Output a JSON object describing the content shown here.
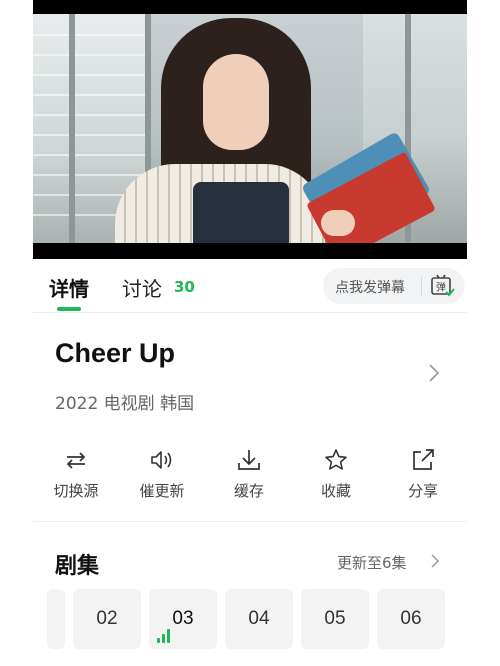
{
  "tabs": {
    "detail_label": "详情",
    "discuss_label": "讨论",
    "discuss_count": "30",
    "danmu_placeholder": "点我发弹幕",
    "danmu_icon_glyph": "弹"
  },
  "show": {
    "title": "Cheer Up",
    "meta": "2022 电视剧 韩国"
  },
  "actions": [
    {
      "label": "切换源",
      "icon": "switch-source-icon"
    },
    {
      "label": "催更新",
      "icon": "speaker-icon"
    },
    {
      "label": "缓存",
      "icon": "download-icon"
    },
    {
      "label": "收藏",
      "icon": "star-icon"
    },
    {
      "label": "分享",
      "icon": "share-icon"
    }
  ],
  "episodes": {
    "heading": "剧集",
    "status": "更新至6集",
    "items": [
      "02",
      "03",
      "04",
      "05",
      "06"
    ],
    "playing": "03"
  },
  "colors": {
    "accent": "#1db954",
    "text": "#111111",
    "muted": "#666666",
    "tile": "#f3f3f4"
  }
}
